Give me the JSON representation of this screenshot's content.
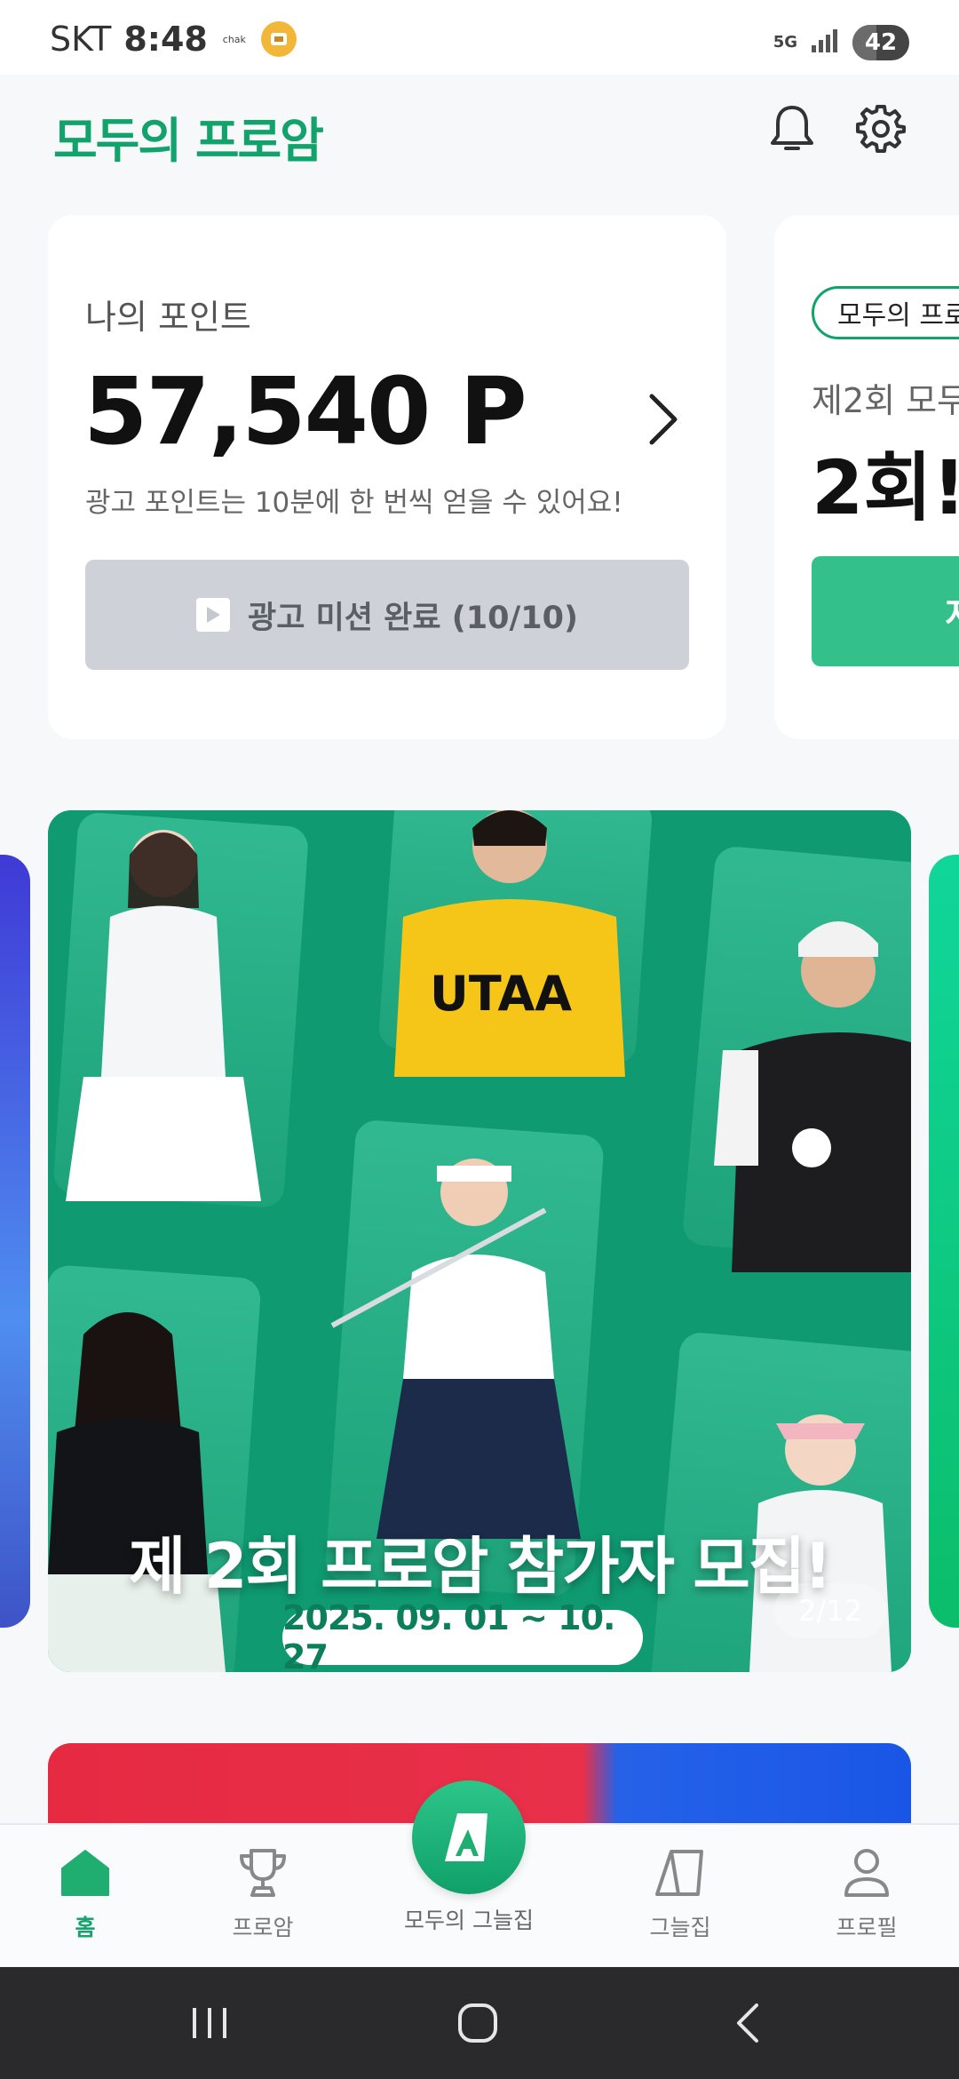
{
  "status_bar": {
    "carrier": "SKT",
    "time": "8:48",
    "chak_logo": "chak",
    "network": "5G",
    "battery": "42",
    "battery_level": 0.42
  },
  "header": {
    "logo": "모두의 프로암",
    "icons": [
      "bell-icon",
      "gear-icon"
    ]
  },
  "points_card": {
    "title": "나의 포인트",
    "value": "57,540 P",
    "note": "광고 포인트는 10분에 한 번씩 얻을 수 있어요!",
    "ad_button_label": "광고 미션 완료 (10/10)"
  },
  "event_card": {
    "pill": "모두의 프로",
    "subtitle": "제2회 모두",
    "big_text": "2회!",
    "button_label": "지"
  },
  "banner": {
    "title": "제 2회 프로암 참가자 모집!",
    "date": "2025. 09. 01 ~ 10. 27",
    "counter": "2/12",
    "colors": {
      "background": "#0f9a72",
      "panel": "#2fb58a"
    }
  },
  "bottom_nav": {
    "items": [
      {
        "label": "홈",
        "icon": "home-icon",
        "active": true
      },
      {
        "label": "프로암",
        "icon": "trophy-icon",
        "active": false
      },
      {
        "label": "모두의 그늘집",
        "icon": "shade-house-icon",
        "active": false
      },
      {
        "label": "그늘집",
        "icon": "shade-icon",
        "active": false
      },
      {
        "label": "프로필",
        "icon": "person-icon",
        "active": false
      }
    ]
  },
  "system_nav": [
    "recent-apps-icon",
    "home-circle-icon",
    "back-icon"
  ],
  "colors": {
    "brand": "#11a36b",
    "accent": "#34c08a"
  }
}
